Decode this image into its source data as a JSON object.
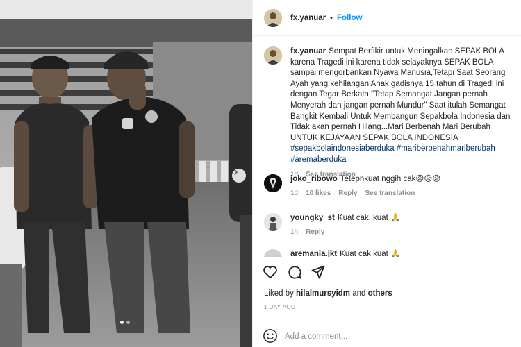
{
  "post": {
    "username": "fx.yanuar",
    "separator": "•",
    "follow_label": "Follow",
    "caption_text": "Sempat Berfikir untuk Meningalkan SEPAK BOLA karena Tragedi ini karena tidak selayaknya SEPAK BOLA sampai mengorbankan Nyawa Manusia,Tetapi Saat Seorang Ayah yang kehilangan Anak gadisnya 15 tahun di Tragedi ini dengan Tegar Berkata \"Tetap Semangat Jangan pernah Menyerah dan jangan pernah Mundur\" Saat itulah Semangat Bangkit Kembali Untuk Membangun Sepakbola Indonesia dan Tidak akan pernah Hilang...Mari Berbenah Mari Berubah UNTUK KEJAYAAN SEPAK BOLA INDONESIA",
    "hashtags": [
      "#sepakbolaindonesiaberduka",
      "#mariberbenahmariberubah",
      "#aremaberduka"
    ],
    "caption_age": "1d",
    "see_translation": "See translation"
  },
  "comments": [
    {
      "username": "joko_ribowo",
      "text": "Tetepnkuat nggih cak😥😥😥",
      "age": "1d",
      "likes": "10 likes",
      "reply": "Reply",
      "see_translation": "See translation"
    },
    {
      "username": "youngky_st",
      "text": "Kuat cak, kuat 🙏",
      "age": "1h",
      "reply": "Reply"
    },
    {
      "username": "aremania.jkt",
      "text": "Kuat cak kuat 🙏"
    }
  ],
  "actions": {
    "icons": [
      "heart-icon",
      "comment-icon",
      "share-icon",
      "bookmark-icon"
    ],
    "liked_prefix": "Liked by",
    "liked_user": "hilalmursyidm",
    "liked_and": "and",
    "liked_others": "others",
    "timestamp": "1 DAY AGO"
  },
  "add_comment": {
    "placeholder": "Add a comment..."
  },
  "carousel": {
    "slide_count": 2,
    "active_index": 1
  },
  "colors": {
    "link": "#0095f6",
    "hashtag": "#00376b",
    "muted": "#8e8e8e",
    "text": "#262626",
    "border": "#efefef"
  }
}
